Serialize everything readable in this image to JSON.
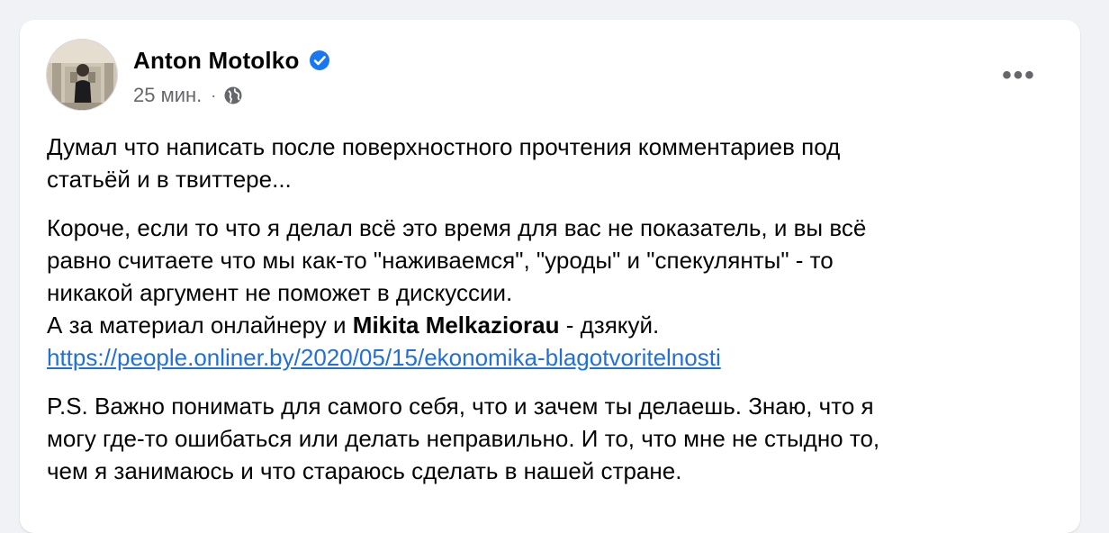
{
  "post": {
    "author": "Anton Motolko",
    "verified": true,
    "timestamp": "25 мин.",
    "separator": "·",
    "privacy_icon": "globe-icon",
    "more_icon": "more-horizontal-icon",
    "more_label": "•••",
    "paragraph1": {
      "line1": "Думал что написать после поверхностного прочтения комментариев под",
      "line2": "статьёй и в твиттере..."
    },
    "paragraph2": {
      "line1": "Короче, если то что я делал всё это время для вас не показатель, и вы всё",
      "line2": "равно считаете что мы как-то \"наживаемся\", \"уроды\" и \"спекулянты\" - то",
      "line3": "никакой аргумент не поможет в дискуссии.",
      "line4_prefix": "А за материал онлайнеру и ",
      "mention": "Mikita Melkaziorau",
      "line4_suffix": " - дзякуй.",
      "link": "https://people.onliner.by/2020/05/15/ekonomika-blagotvoritelnosti"
    },
    "paragraph3": {
      "line1": "P.S. Важно понимать для самого себя, что и зачем ты делаешь. Знаю, что я",
      "line2": "могу где-то ошибаться или делать неправильно. И то, что мне не стыдно то,",
      "line3": "чем я занимаюсь и что стараюсь сделать в нашей стране."
    }
  },
  "colors": {
    "background": "#f0f2f5",
    "card": "#ffffff",
    "text": "#050505",
    "secondary": "#65676b",
    "link": "#216fdb",
    "verified_badge": "#1877f2"
  }
}
